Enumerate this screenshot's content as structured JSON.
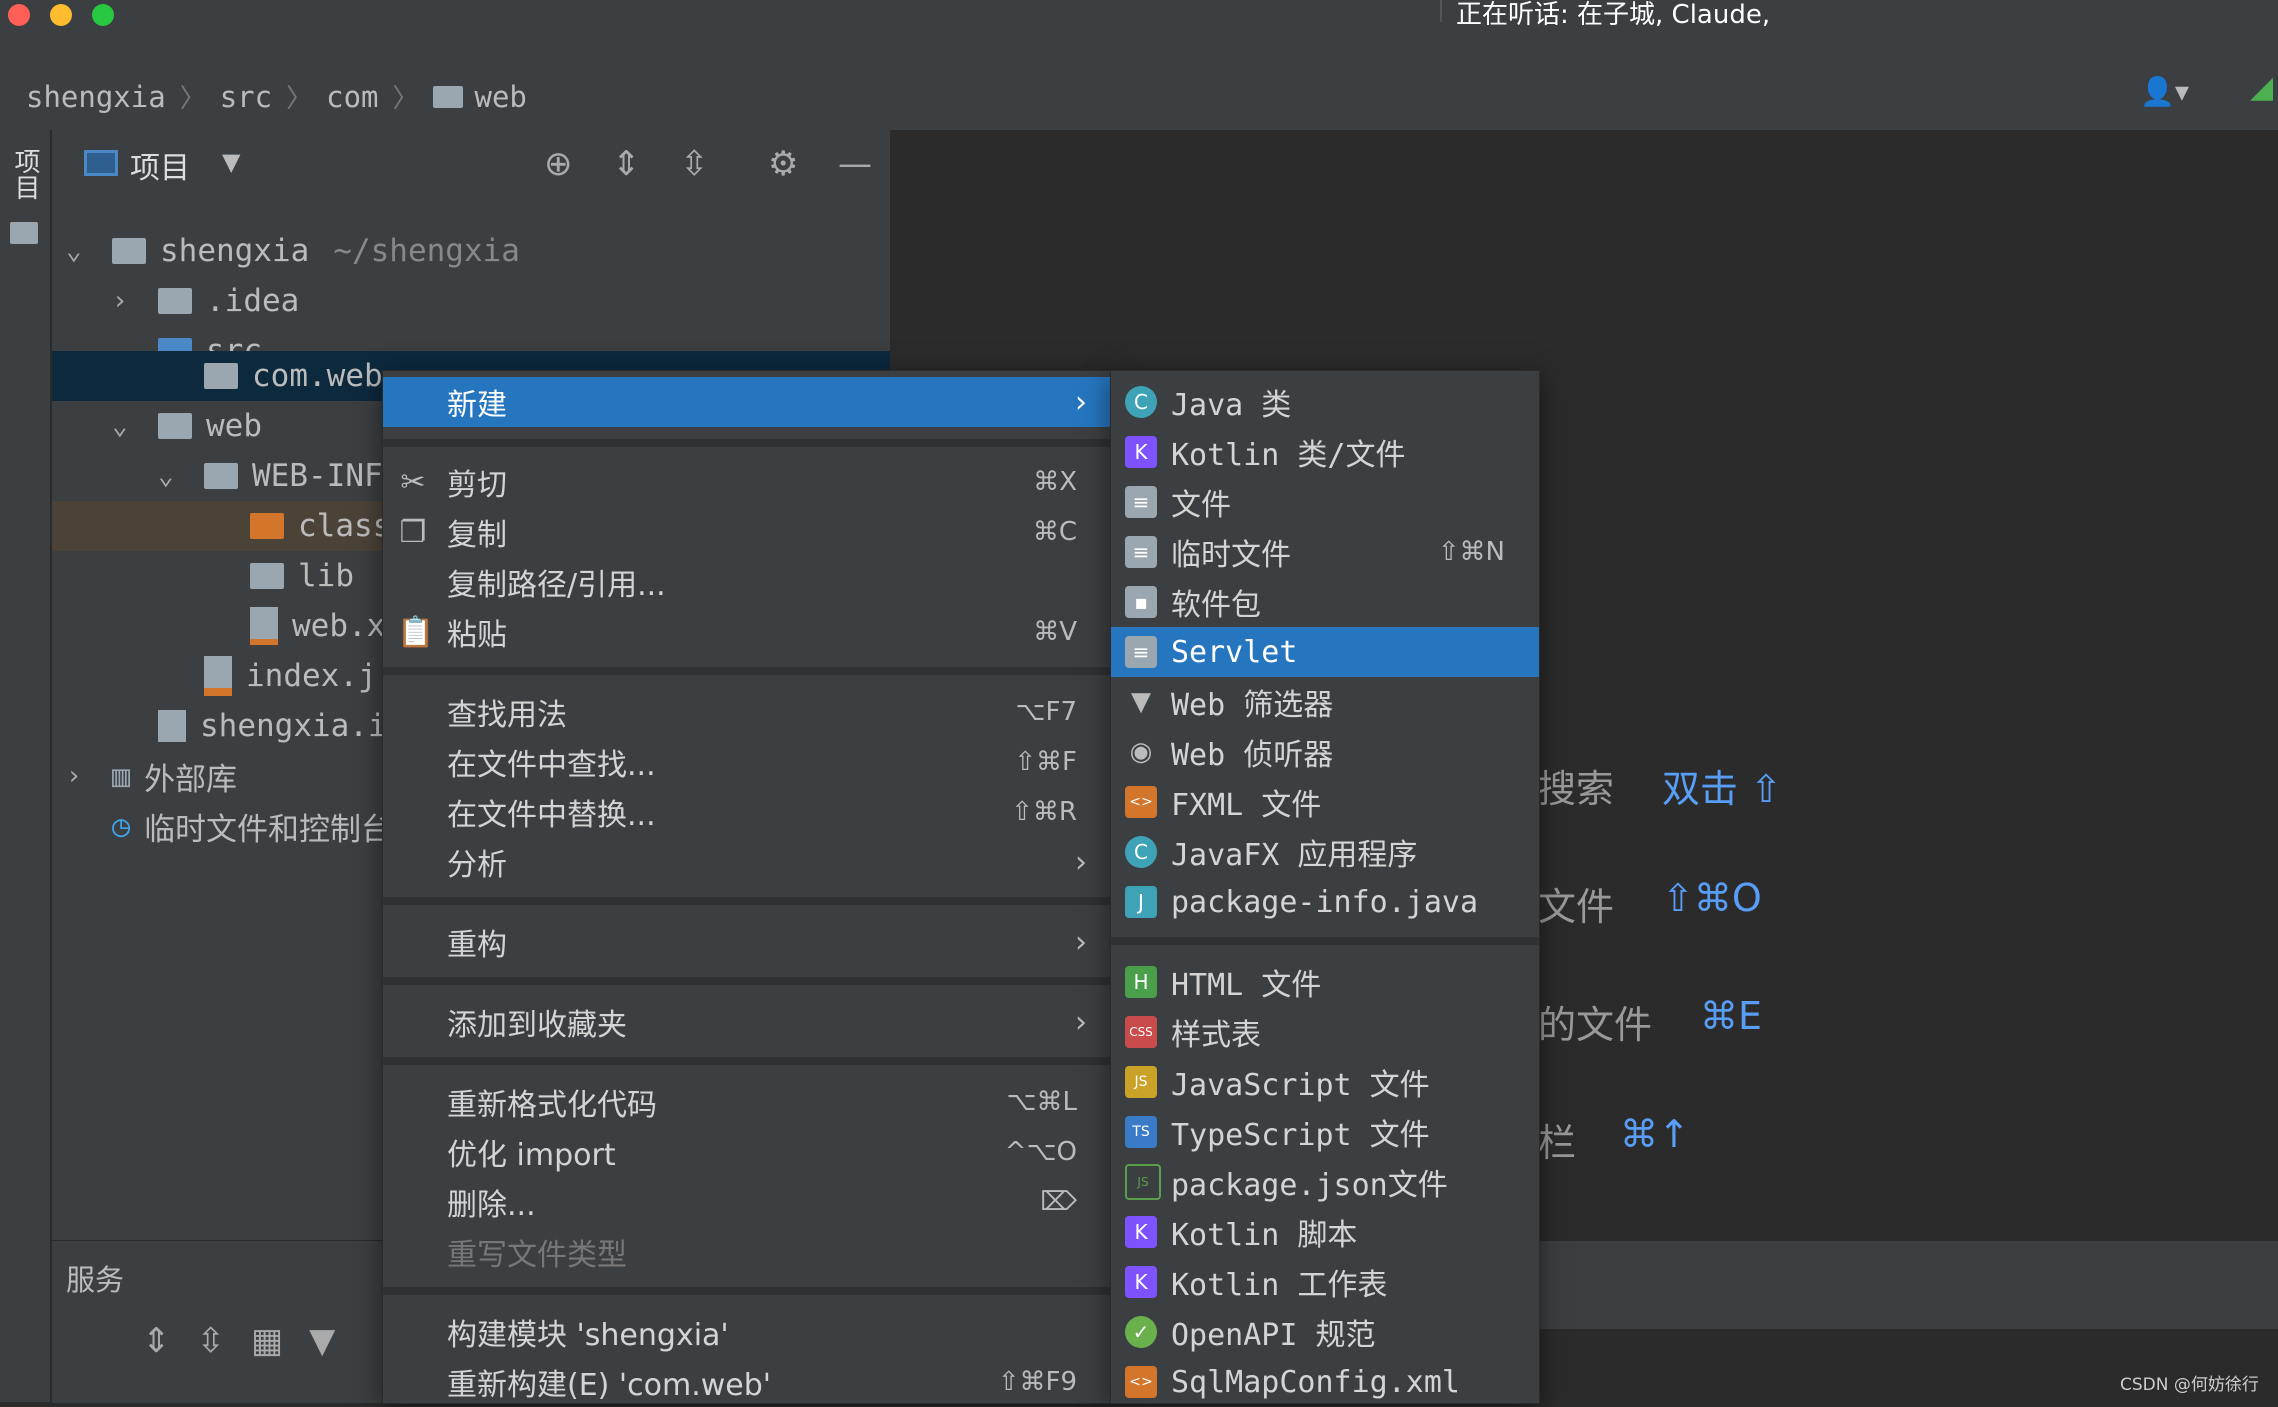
{
  "window": {
    "status_text": "正在听话: 在子城, Claude,",
    "traffic_colors": [
      "#ff5f57",
      "#febc2e",
      "#28c840"
    ]
  },
  "breadcrumb": [
    "shengxia",
    "src",
    "com",
    "web"
  ],
  "side_strip": {
    "label": "项目"
  },
  "project_panel": {
    "title": "项目",
    "tree": [
      {
        "name": "shengxia",
        "path": "~/shengxia",
        "icon": "module-folder"
      },
      {
        "name": ".idea",
        "icon": "folder"
      },
      {
        "name": "src",
        "icon": "source-folder"
      },
      {
        "name": "com.web",
        "icon": "package-folder"
      },
      {
        "name": "web",
        "icon": "web-folder"
      },
      {
        "name": "WEB-INF",
        "icon": "folder"
      },
      {
        "name": "class",
        "icon": "excluded-folder"
      },
      {
        "name": "lib",
        "icon": "folder"
      },
      {
        "name": "web.x",
        "icon": "xml-file"
      },
      {
        "name": "index.j",
        "icon": "jsp-file"
      },
      {
        "name": "shengxia.i",
        "icon": "iml-file"
      },
      {
        "name": "外部库",
        "icon": "library"
      },
      {
        "name": "临时文件和控制台",
        "icon": "scratch"
      }
    ]
  },
  "services": {
    "title": "服务"
  },
  "editor_hints": [
    {
      "label": "搜索",
      "key": "双击 ⇧"
    },
    {
      "label": "文件",
      "key": "⇧⌘O"
    },
    {
      "label": "的文件",
      "key": "⌘E"
    },
    {
      "label": "栏",
      "key": "⌘↑"
    }
  ],
  "context_menu": {
    "items": [
      {
        "label": "新建",
        "arrow": "›",
        "active": true
      },
      {
        "label": "剪切",
        "shortcut": "⌘X",
        "icon": "cut-icon"
      },
      {
        "label": "复制",
        "shortcut": "⌘C",
        "icon": "copy-icon"
      },
      {
        "label": "复制路径/引用..."
      },
      {
        "label": "粘贴",
        "shortcut": "⌘V",
        "icon": "paste-icon"
      },
      {
        "label": "查找用法",
        "shortcut": "⌥F7"
      },
      {
        "label": "在文件中查找...",
        "shortcut": "⇧⌘F"
      },
      {
        "label": "在文件中替换...",
        "shortcut": "⇧⌘R"
      },
      {
        "label": "分析",
        "arrow": "›"
      },
      {
        "label": "重构",
        "arrow": "›"
      },
      {
        "label": "添加到收藏夹",
        "arrow": "›"
      },
      {
        "label": "重新格式化代码",
        "shortcut": "⌥⌘L"
      },
      {
        "label": "优化 import",
        "shortcut": "^⌥O"
      },
      {
        "label": "删除...",
        "shortcut": "⌦"
      },
      {
        "label": "重写文件类型",
        "disabled": true
      },
      {
        "label": "构建模块 'shengxia'"
      },
      {
        "label": "重新构建(E) 'com.web'",
        "shortcut": "⇧⌘F9"
      }
    ]
  },
  "new_submenu": {
    "items": [
      {
        "label": "Java 类",
        "icon": "java-class-icon",
        "glyph": "C"
      },
      {
        "label": "Kotlin 类/文件",
        "icon": "kotlin-file-icon",
        "glyph": "K"
      },
      {
        "label": "文件",
        "icon": "file-icon",
        "glyph": "≡"
      },
      {
        "label": "临时文件",
        "shortcut": "⇧⌘N",
        "icon": "scratch-file-icon",
        "glyph": "≡"
      },
      {
        "label": "软件包",
        "icon": "package-icon",
        "glyph": "▪"
      },
      {
        "label": "Servlet",
        "icon": "servlet-icon",
        "glyph": "≡",
        "active": true
      },
      {
        "label": "Web 筛选器",
        "icon": "filter-icon",
        "glyph": "▼"
      },
      {
        "label": "Web 侦听器",
        "icon": "listener-icon",
        "glyph": "◉"
      },
      {
        "label": "FXML 文件",
        "icon": "fxml-file-icon",
        "glyph": "<>"
      },
      {
        "label": "JavaFX 应用程序",
        "icon": "javafx-app-icon",
        "glyph": "C"
      },
      {
        "label": "package-info.java",
        "icon": "package-info-icon",
        "glyph": "J"
      },
      {
        "label": "HTML 文件",
        "icon": "html-file-icon",
        "glyph": "H"
      },
      {
        "label": "样式表",
        "icon": "css-file-icon",
        "glyph": "CSS"
      },
      {
        "label": "JavaScript 文件",
        "icon": "js-file-icon",
        "glyph": "JS"
      },
      {
        "label": "TypeScript 文件",
        "icon": "ts-file-icon",
        "glyph": "TS"
      },
      {
        "label": "package.json文件",
        "icon": "nodejs-icon",
        "glyph": "JS"
      },
      {
        "label": "Kotlin 脚本",
        "icon": "kotlin-script-icon",
        "glyph": "K"
      },
      {
        "label": "Kotlin 工作表",
        "icon": "kotlin-worksheet-icon",
        "glyph": "K"
      },
      {
        "label": "OpenAPI 规范",
        "icon": "openapi-icon",
        "glyph": "✓"
      },
      {
        "label": "SqlMapConfig.xml",
        "icon": "xml-config-icon",
        "glyph": "<>"
      }
    ]
  },
  "watermark": "CSDN @何妨徐行",
  "colors": {
    "accent": "#2675bf",
    "selection": "#0d293e",
    "bg": "#2b2b2b",
    "panel": "#3c3f41"
  }
}
